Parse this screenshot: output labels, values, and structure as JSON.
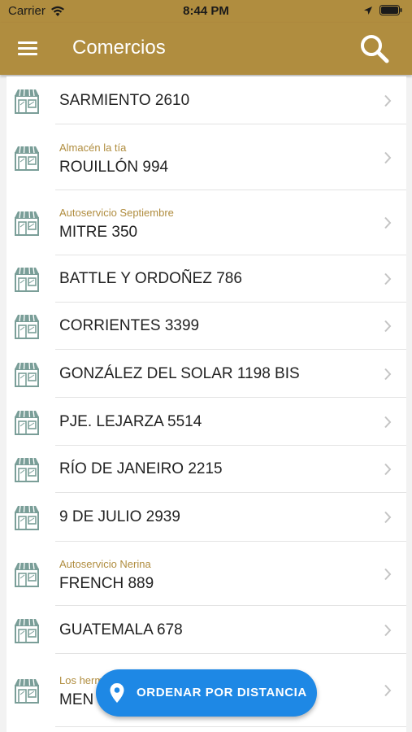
{
  "status_bar": {
    "carrier": "Carrier",
    "time": "8:44 PM"
  },
  "app_bar": {
    "title": "Comercios",
    "menu_icon": "menu-icon",
    "search_icon": "search-icon"
  },
  "colors": {
    "primary": "#b08d3f",
    "fab": "#1e88e5",
    "store_icon": "#7a9e98"
  },
  "stores": [
    {
      "subtitle": "",
      "address": "SARMIENTO 2610"
    },
    {
      "subtitle": "Almacén la tía",
      "address": "ROUILLÓN 994"
    },
    {
      "subtitle": "Autoservicio Septiembre",
      "address": "MITRE 350"
    },
    {
      "subtitle": "",
      "address": "BATTLE Y ORDOÑEZ 786"
    },
    {
      "subtitle": "",
      "address": "CORRIENTES 3399"
    },
    {
      "subtitle": "",
      "address": "GONZÁLEZ DEL SOLAR 1198 BIS"
    },
    {
      "subtitle": "",
      "address": "PJE. LEJARZA 5514"
    },
    {
      "subtitle": "",
      "address": "RÍO DE JANEIRO 2215"
    },
    {
      "subtitle": "",
      "address": "9 DE JULIO 2939"
    },
    {
      "subtitle": "Autoservicio Nerina",
      "address": "FRENCH 889"
    },
    {
      "subtitle": "",
      "address": "GUATEMALA 678"
    },
    {
      "subtitle": "Los herm",
      "address": "MEN"
    }
  ],
  "fab": {
    "label": "ORDENAR POR DISTANCIA",
    "icon": "location-pin-icon"
  }
}
